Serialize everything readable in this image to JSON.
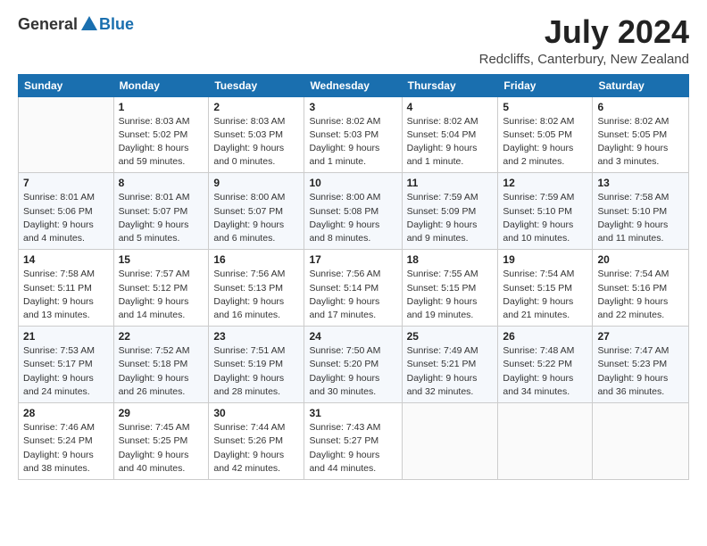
{
  "logo": {
    "general": "General",
    "blue": "Blue"
  },
  "title": {
    "month_year": "July 2024",
    "location": "Redcliffs, Canterbury, New Zealand"
  },
  "days_header": [
    "Sunday",
    "Monday",
    "Tuesday",
    "Wednesday",
    "Thursday",
    "Friday",
    "Saturday"
  ],
  "weeks": [
    [
      {
        "num": "",
        "info": ""
      },
      {
        "num": "1",
        "info": "Sunrise: 8:03 AM\nSunset: 5:02 PM\nDaylight: 8 hours\nand 59 minutes."
      },
      {
        "num": "2",
        "info": "Sunrise: 8:03 AM\nSunset: 5:03 PM\nDaylight: 9 hours\nand 0 minutes."
      },
      {
        "num": "3",
        "info": "Sunrise: 8:02 AM\nSunset: 5:03 PM\nDaylight: 9 hours\nand 1 minute."
      },
      {
        "num": "4",
        "info": "Sunrise: 8:02 AM\nSunset: 5:04 PM\nDaylight: 9 hours\nand 1 minute."
      },
      {
        "num": "5",
        "info": "Sunrise: 8:02 AM\nSunset: 5:05 PM\nDaylight: 9 hours\nand 2 minutes."
      },
      {
        "num": "6",
        "info": "Sunrise: 8:02 AM\nSunset: 5:05 PM\nDaylight: 9 hours\nand 3 minutes."
      }
    ],
    [
      {
        "num": "7",
        "info": "Sunrise: 8:01 AM\nSunset: 5:06 PM\nDaylight: 9 hours\nand 4 minutes."
      },
      {
        "num": "8",
        "info": "Sunrise: 8:01 AM\nSunset: 5:07 PM\nDaylight: 9 hours\nand 5 minutes."
      },
      {
        "num": "9",
        "info": "Sunrise: 8:00 AM\nSunset: 5:07 PM\nDaylight: 9 hours\nand 6 minutes."
      },
      {
        "num": "10",
        "info": "Sunrise: 8:00 AM\nSunset: 5:08 PM\nDaylight: 9 hours\nand 8 minutes."
      },
      {
        "num": "11",
        "info": "Sunrise: 7:59 AM\nSunset: 5:09 PM\nDaylight: 9 hours\nand 9 minutes."
      },
      {
        "num": "12",
        "info": "Sunrise: 7:59 AM\nSunset: 5:10 PM\nDaylight: 9 hours\nand 10 minutes."
      },
      {
        "num": "13",
        "info": "Sunrise: 7:58 AM\nSunset: 5:10 PM\nDaylight: 9 hours\nand 11 minutes."
      }
    ],
    [
      {
        "num": "14",
        "info": "Sunrise: 7:58 AM\nSunset: 5:11 PM\nDaylight: 9 hours\nand 13 minutes."
      },
      {
        "num": "15",
        "info": "Sunrise: 7:57 AM\nSunset: 5:12 PM\nDaylight: 9 hours\nand 14 minutes."
      },
      {
        "num": "16",
        "info": "Sunrise: 7:56 AM\nSunset: 5:13 PM\nDaylight: 9 hours\nand 16 minutes."
      },
      {
        "num": "17",
        "info": "Sunrise: 7:56 AM\nSunset: 5:14 PM\nDaylight: 9 hours\nand 17 minutes."
      },
      {
        "num": "18",
        "info": "Sunrise: 7:55 AM\nSunset: 5:15 PM\nDaylight: 9 hours\nand 19 minutes."
      },
      {
        "num": "19",
        "info": "Sunrise: 7:54 AM\nSunset: 5:15 PM\nDaylight: 9 hours\nand 21 minutes."
      },
      {
        "num": "20",
        "info": "Sunrise: 7:54 AM\nSunset: 5:16 PM\nDaylight: 9 hours\nand 22 minutes."
      }
    ],
    [
      {
        "num": "21",
        "info": "Sunrise: 7:53 AM\nSunset: 5:17 PM\nDaylight: 9 hours\nand 24 minutes."
      },
      {
        "num": "22",
        "info": "Sunrise: 7:52 AM\nSunset: 5:18 PM\nDaylight: 9 hours\nand 26 minutes."
      },
      {
        "num": "23",
        "info": "Sunrise: 7:51 AM\nSunset: 5:19 PM\nDaylight: 9 hours\nand 28 minutes."
      },
      {
        "num": "24",
        "info": "Sunrise: 7:50 AM\nSunset: 5:20 PM\nDaylight: 9 hours\nand 30 minutes."
      },
      {
        "num": "25",
        "info": "Sunrise: 7:49 AM\nSunset: 5:21 PM\nDaylight: 9 hours\nand 32 minutes."
      },
      {
        "num": "26",
        "info": "Sunrise: 7:48 AM\nSunset: 5:22 PM\nDaylight: 9 hours\nand 34 minutes."
      },
      {
        "num": "27",
        "info": "Sunrise: 7:47 AM\nSunset: 5:23 PM\nDaylight: 9 hours\nand 36 minutes."
      }
    ],
    [
      {
        "num": "28",
        "info": "Sunrise: 7:46 AM\nSunset: 5:24 PM\nDaylight: 9 hours\nand 38 minutes."
      },
      {
        "num": "29",
        "info": "Sunrise: 7:45 AM\nSunset: 5:25 PM\nDaylight: 9 hours\nand 40 minutes."
      },
      {
        "num": "30",
        "info": "Sunrise: 7:44 AM\nSunset: 5:26 PM\nDaylight: 9 hours\nand 42 minutes."
      },
      {
        "num": "31",
        "info": "Sunrise: 7:43 AM\nSunset: 5:27 PM\nDaylight: 9 hours\nand 44 minutes."
      },
      {
        "num": "",
        "info": ""
      },
      {
        "num": "",
        "info": ""
      },
      {
        "num": "",
        "info": ""
      }
    ]
  ]
}
